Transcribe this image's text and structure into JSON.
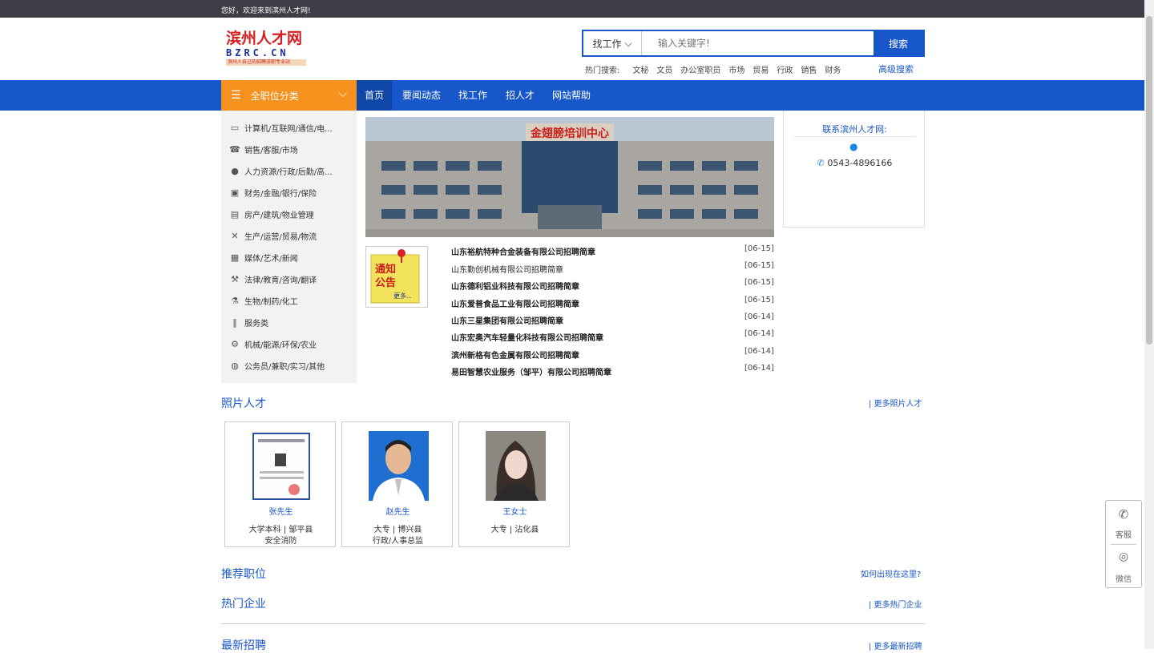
{
  "topbar": {
    "welcome": "您好，欢迎来到滨州人才网!"
  },
  "logo": {
    "line1": "滨州人才网",
    "line2": "BZRC.CN",
    "line3": "滨州人自己的招聘求职专业站"
  },
  "search": {
    "type_label": "找工作",
    "placeholder": "输入关键字!",
    "button": "搜索",
    "hot_label": "热门搜索:",
    "hot": [
      "文秘",
      "文员",
      "办公室职员",
      "市场",
      "贸易",
      "行政",
      "销售",
      "财务"
    ],
    "advanced": "高级搜索"
  },
  "nav": {
    "category_label": "全职位分类",
    "items": [
      "首页",
      "要闻动态",
      "找工作",
      "招人才",
      "网站帮助"
    ]
  },
  "categories": [
    "计算机/互联网/通信/电...",
    "销售/客服/市场",
    "人力资源/行政/后勤/高...",
    "财务/金融/银行/保险",
    "房产/建筑/物业管理",
    "生产/运营/贸易/物流",
    "媒体/艺术/新闻",
    "法律/教育/咨询/翻译",
    "生物/制药/化工",
    "服务类",
    "机械/能源/环保/农业",
    "公务员/兼职/实习/其他"
  ],
  "banner": {
    "sign": "金翅膀培训中心"
  },
  "notice": {
    "text1": "通知",
    "text2": "公告",
    "more": "更多..."
  },
  "news": [
    {
      "title": "山东裕航特种合金装备有限公司招聘简章",
      "date": "[06-15]",
      "bold": true
    },
    {
      "title": "山东勤创机械有限公司招聘简章",
      "date": "[06-15]",
      "bold": false
    },
    {
      "title": "山东德利铝业科技有限公司招聘简章",
      "date": "[06-15]",
      "bold": true
    },
    {
      "title": "山东爱普食品工业有限公司招聘简章",
      "date": "[06-15]",
      "bold": true
    },
    {
      "title": "山东三星集团有限公司招聘简章",
      "date": "[06-14]",
      "bold": true
    },
    {
      "title": "山东宏奥汽车轻量化科技有限公司招聘简章",
      "date": "[06-14]",
      "bold": true
    },
    {
      "title": "滨州新格有色金属有限公司招聘简章",
      "date": "[06-14]",
      "bold": true
    },
    {
      "title": "易田智慧农业服务（邹平）有限公司招聘简章",
      "date": "[06-14]",
      "bold": true
    }
  ],
  "contact": {
    "title": "联系滨州人才网:",
    "phone": "0543-4896166"
  },
  "photo_talent": {
    "title": "照片人才",
    "more": "| 更多照片人才",
    "cards": [
      {
        "name": "张先生",
        "line1": "大学本科 | 邹平县",
        "line2": "安全消防"
      },
      {
        "name": "赵先生",
        "line1": "大专 | 博兴县",
        "line2": "行政/人事总监"
      },
      {
        "name": "王女士",
        "line1": "大专 | 沾化县",
        "line2": ""
      }
    ]
  },
  "recommended": {
    "title": "推荐职位",
    "more": "如何出现在这里?"
  },
  "hot_companies": {
    "title": "热门企业",
    "more": "| 更多热门企业"
  },
  "latest": {
    "title": "最新招聘",
    "more": "| 更多最新招聘"
  },
  "float": {
    "service": "客服",
    "wechat": "微信"
  }
}
